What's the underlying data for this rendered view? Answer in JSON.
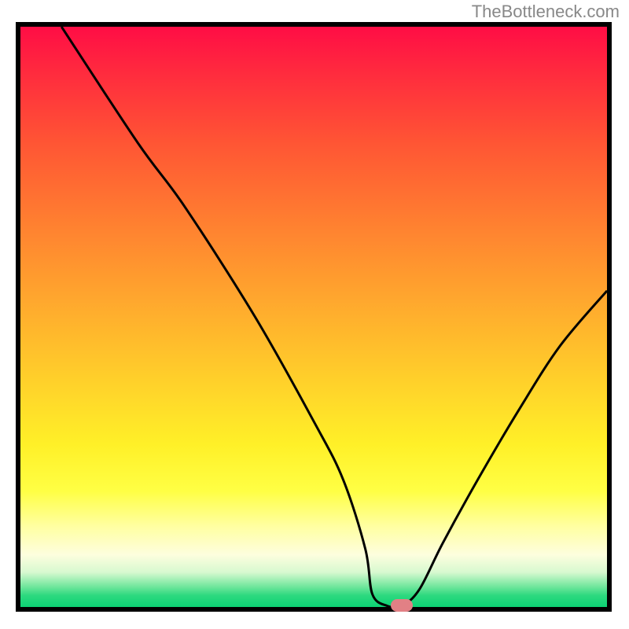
{
  "watermark": "TheBottleneck.com",
  "chart_data": {
    "type": "line",
    "title": "",
    "xlabel": "",
    "ylabel": "",
    "xlim": [
      0,
      100
    ],
    "ylim": [
      0,
      100
    ],
    "curve": {
      "x": [
        7.0,
        20.0,
        28.0,
        40.0,
        50.0,
        55.0,
        58.8,
        60.0,
        62.5,
        65.0,
        68.0,
        72.0,
        78.0,
        85.0,
        92.0,
        100.0
      ],
      "y": [
        100.0,
        80.0,
        69.0,
        50.0,
        32.0,
        22.0,
        10.0,
        2.2,
        0.2,
        0.2,
        3.0,
        11.0,
        22.0,
        34.0,
        45.0,
        54.5
      ]
    },
    "marker": {
      "x": 65.0,
      "y": 0.0,
      "color": "#e28085"
    },
    "background_gradient": {
      "top": "#ff0d45",
      "mid": "#ffd32a",
      "bottom": "#0cd274"
    }
  }
}
